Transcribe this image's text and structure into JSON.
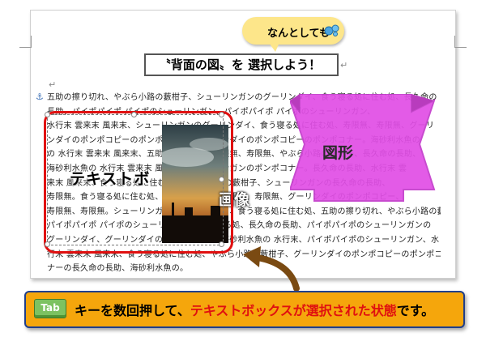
{
  "callout": {
    "text": "なんとしても",
    "icon": "bubbles-icon"
  },
  "title": "〝背面の図〟を 選択しよう！",
  "paragraph": {
    "lines": [
      "五助の擦り切れ、やぶら小路の藪柑子、シューリンガンのグーリンダイ、食う寝る処に住む処、長久命の",
      "長助、パイポパイポ パイポのシューリンガン、パイポパイポ パイポのシューリンガン、",
      "水行末 雲来末 風来末、シューリンガンのグーリンダイ、食う寝る処に住む処、寿限無、寿限無、グーリ",
      "ンダイのポンポコピーのポンポコナー。グーリンダイのポンポコピーのポンポコナー。海砂利水魚の",
      "の 水行末 雲来末 風来末、五助の擦り切れ、寿限無、寿限無、やぶら小路の藪柑子、長久命の長助、",
      "海砂利水魚の 水行末 雲来末 風来末、シューリンガンのポンポコナー。長久命の長助、水行末 雲",
      "来末 風来末、食う寝る処に住む処、やぶら小路の藪柑子、シューリンガンの長久命の長助、",
      "寿限無。食う寝る処に住む処、パイポパイポの寿限無、寿限無、グーリンダイのポンポコピー、",
      "寿限無、寿限無。シューリンガンのグーリンダイ、食う寝る処に住む処、五助の擦り切れ、やぶら小路の藪柑子、",
      "パイポパイポ パイポのシューリンガン、食う寝る処、長久命の長助、パイポパイポのシューリンガンの",
      "グーリンダイ、グーリンダイのポンポコピー、海砂利水魚の 水行末、パイポパイポのシューリンガン、水",
      "行末 雲来末 風来末、食う寝る処に住む処、やぶら小路の藪柑子、グーリンダイのポンポコピーのポンポコ",
      "ナーの長久命の長助、海砂利水魚の。"
    ]
  },
  "textbox": {
    "label": "テキストボ"
  },
  "image": {
    "label": "画像"
  },
  "shape": {
    "label": "図形"
  },
  "banner": {
    "key": "Tab",
    "text_before": "キーを数回押して、",
    "text_highlight": "テキストボックスが選択された状態",
    "text_after": "です。"
  },
  "colors": {
    "highlight": "#e01010",
    "banner_bg": "#f5a60c",
    "shape_fill": "#e14ee6",
    "key_green": "#7cc261"
  }
}
